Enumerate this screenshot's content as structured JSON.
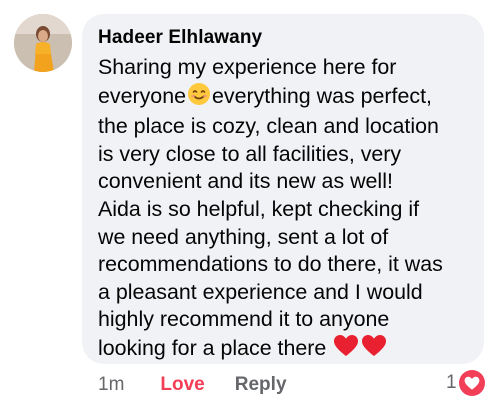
{
  "comment": {
    "author": "Hadeer Elhlawany",
    "lines": [
      "Sharing my experience  here for",
      "everyone",
      "everything was perfect,",
      "the place is cozy, clean and location",
      "is very close to all facilities, very",
      "convenient and its new as well!",
      "Aida is so helpful, kept checking if",
      "we need anything, sent a lot of",
      "recommendations to do there, it was",
      "a pleasant experience and I would",
      "highly recommend it to anyone",
      "looking for a place there"
    ],
    "emojis": [
      "smiling-face-emoji",
      "red-heart-emoji",
      "red-heart-emoji"
    ]
  },
  "actions": {
    "time": "1m",
    "love_label": "Love",
    "reply_label": "Reply"
  },
  "reaction": {
    "count": "1",
    "icon": "heart-icon",
    "color": "#f33e58"
  },
  "colors": {
    "bubble": "#f0f2f5",
    "meta_text": "#65676b",
    "love": "#f33e58",
    "text": "#050505"
  }
}
